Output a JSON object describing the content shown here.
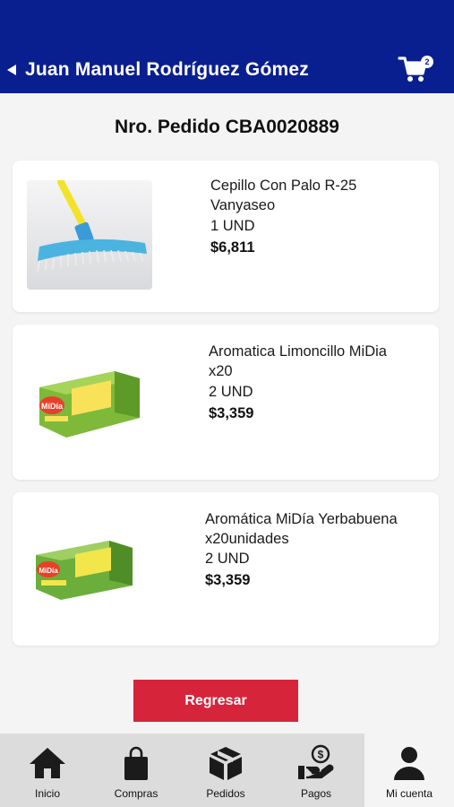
{
  "header": {
    "user_name": "Juan Manuel Rodríguez Gómez",
    "cart_count": "2"
  },
  "order": {
    "title": "Nro. Pedido CBA0020889"
  },
  "items": [
    {
      "name_line1": "Cepillo Con Palo R-25",
      "name_line2": "Vanyaseo",
      "quantity": "1 UND",
      "price": "$6,811"
    },
    {
      "name_line1": "Aromatica Limoncillo MiDia",
      "name_line2": "x20",
      "quantity": "2 UND",
      "price": "$3,359"
    },
    {
      "name_line1": "Aromática MiDía Yerbabuena",
      "name_line2": "x20unidades",
      "quantity": "2 UND",
      "price": "$3,359"
    }
  ],
  "product_image_text": {
    "brand": "MiDía"
  },
  "actions": {
    "back_label": "Regresar"
  },
  "nav": [
    {
      "label": "Inicio",
      "icon": "home-icon"
    },
    {
      "label": "Compras",
      "icon": "shopping-bag-icon"
    },
    {
      "label": "Pedidos",
      "icon": "box-icon"
    },
    {
      "label": "Pagos",
      "icon": "payment-hand-icon"
    },
    {
      "label": "Mi cuenta",
      "icon": "user-icon"
    }
  ],
  "colors": {
    "header": "#0a1f8f",
    "primary_button": "#d6243a",
    "navbar": "#dcdcdc",
    "active_tab": "#f4f4f5"
  }
}
